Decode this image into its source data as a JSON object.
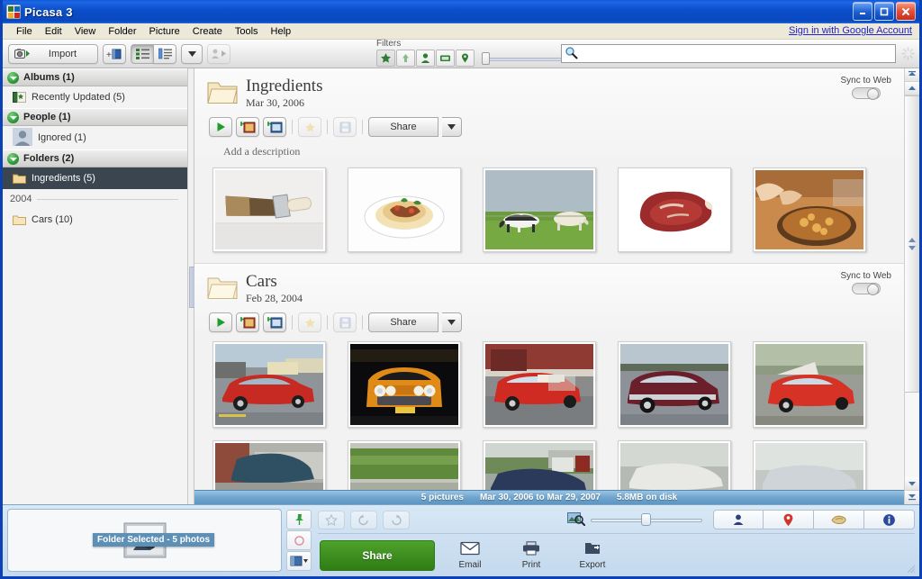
{
  "window": {
    "title": "Picasa 3",
    "icon": "picasa-logo-icon",
    "minimize": "minimize-icon",
    "maximize": "maximize-icon",
    "close": "close-icon"
  },
  "menubar": {
    "items": [
      "File",
      "Edit",
      "View",
      "Folder",
      "Picture",
      "Create",
      "Tools",
      "Help"
    ],
    "signin_link": "Sign in with Google Account"
  },
  "toolbar": {
    "import_label": "Import",
    "add_album_icon": "add-album-icon",
    "view_list_icon": "list-view-icon",
    "view_detail_icon": "detail-view-icon",
    "dropdown_icon": "chevron-down-icon",
    "slideshow_icon": "person-slideshow-icon",
    "filters_label": "Filters",
    "filter_buttons": [
      "star-filter-icon",
      "upload-filter-icon",
      "people-filter-icon",
      "video-filter-icon",
      "geotag-filter-icon"
    ],
    "filter_slider_value": 0,
    "search_icon": "search-icon",
    "search_value": "",
    "search_placeholder": "",
    "busy_icon": "spinner-icon"
  },
  "sidebar": {
    "sections": [
      {
        "name": "Albums (1)",
        "items": [
          {
            "label": "Recently Updated (5)",
            "icon": "album-icon",
            "selected": false
          }
        ]
      },
      {
        "name": "People (1)",
        "items": [
          {
            "label": "Ignored (1)",
            "icon": "person-icon",
            "selected": false
          }
        ]
      },
      {
        "name": "Folders (2)",
        "items": [
          {
            "label": "Ingredients (5)",
            "icon": "folder-icon",
            "selected": true
          }
        ],
        "year": "2004",
        "year_items": [
          {
            "label": "Cars (10)",
            "icon": "folder-icon",
            "selected": false
          }
        ]
      }
    ]
  },
  "folders": [
    {
      "name": "Ingredients",
      "date": "Mar 30, 2006",
      "sync_label": "Sync to Web",
      "sync_on": false,
      "description_placeholder": "Add a description",
      "actions": {
        "play_icon": "play-slideshow-icon",
        "collage_icon": "create-collage-icon",
        "movie_icon": "create-movie-icon",
        "star_icon": "star-icon",
        "save_icon": "save-icon",
        "share_label": "Share",
        "share_arrow_icon": "chevron-down-icon"
      },
      "photos": [
        {
          "name": "paint-brush",
          "alt": "Paint brush on white surface"
        },
        {
          "name": "pasta-plate",
          "alt": "Plate of pasta with meat sauce"
        },
        {
          "name": "cows-grazing",
          "alt": "Cows grazing in green field"
        },
        {
          "name": "raw-steak",
          "alt": "Raw beef steak on white"
        },
        {
          "name": "cooking-wok",
          "alt": "Hands cooking in a pan"
        }
      ]
    },
    {
      "name": "Cars",
      "date": "Feb 28, 2004",
      "sync_label": "Sync to Web",
      "sync_on": false,
      "actions": {
        "play_icon": "play-slideshow-icon",
        "collage_icon": "create-collage-icon",
        "movie_icon": "create-movie-icon",
        "star_icon": "star-icon",
        "save_icon": "save-icon",
        "share_label": "Share",
        "share_arrow_icon": "chevron-down-icon"
      },
      "photos": [
        {
          "name": "red-chevelle",
          "alt": "Red muscle car in parking lot"
        },
        {
          "name": "orange-gto",
          "alt": "Orange Pontiac GTO front view"
        },
        {
          "name": "red-belair",
          "alt": "Red classic Chevrolet Bel Air"
        },
        {
          "name": "maroon-belair",
          "alt": "Dark maroon classic car"
        },
        {
          "name": "red-coupe-hood",
          "alt": "Red car with hood open"
        }
      ],
      "photos_row2": [
        {
          "name": "green-car-brick",
          "alt": "Car beside brick building"
        },
        {
          "name": "hedge-row",
          "alt": "Green hedges"
        },
        {
          "name": "street-car",
          "alt": "Car on suburban street"
        },
        {
          "name": "white-car",
          "alt": "White car"
        },
        {
          "name": "silver-car",
          "alt": "Silver car"
        }
      ]
    }
  ],
  "status": {
    "count": "5 pictures",
    "range": "Mar 30, 2006 to Mar 29, 2007",
    "size": "5.8MB on disk"
  },
  "tray": {
    "badge": "Folder Selected - 5 photos",
    "pin_icon": "pin-icon",
    "clear_icon": "clear-selection-icon",
    "album_icon": "add-to-album-icon",
    "album_arrow_icon": "chevron-down-icon",
    "star_button_icon": "star-icon",
    "rotate_left_icon": "rotate-left-icon",
    "rotate_right_icon": "rotate-right-icon",
    "zoom_icon": "thumbnail-size-icon",
    "zoom_value": 45,
    "view_buttons": [
      "people-view-icon",
      "places-view-icon",
      "tags-view-icon",
      "info-view-icon"
    ],
    "share_label": "Share",
    "actions": [
      {
        "label": "Email",
        "icon": "email-icon"
      },
      {
        "label": "Print",
        "icon": "print-icon"
      },
      {
        "label": "Export",
        "icon": "export-icon"
      }
    ]
  },
  "scrollbar": {
    "up_icon": "scroll-up-icon",
    "page_up_icon": "page-up-icon",
    "down_icon": "scroll-down-icon",
    "page_down_icon": "page-down-icon"
  },
  "colors": {
    "titlebar": "#0b4fcc",
    "accent_green": "#3f9021",
    "selection": "#3a4550",
    "status_bar": "#6fa5ce"
  }
}
